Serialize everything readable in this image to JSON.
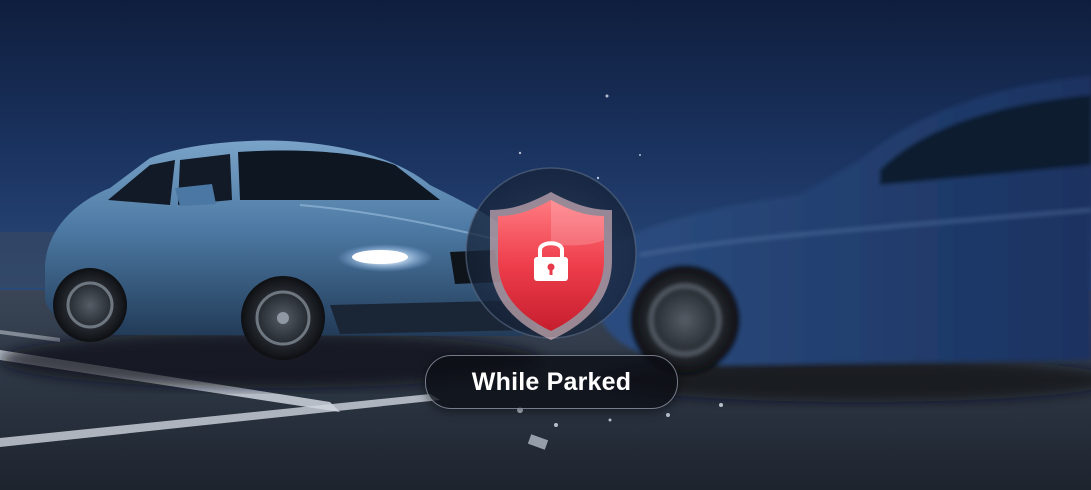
{
  "overlay": {
    "label": "While Parked",
    "shield_icon": "shield-lock-icon"
  },
  "colors": {
    "sky": "#1a2f56",
    "ground": "#29323f",
    "car": "#3f6c96",
    "shield": "#e83a48",
    "pill_bg": "#0c0e14"
  }
}
